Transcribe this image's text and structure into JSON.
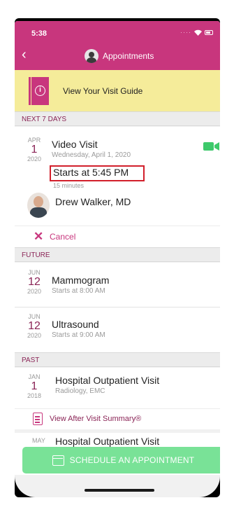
{
  "status": {
    "time": "5:38"
  },
  "nav": {
    "back": "‹",
    "title": "Appointments"
  },
  "guide": {
    "label": "View Your Visit Guide"
  },
  "sections": {
    "next7": "NEXT 7 DAYS",
    "future": "FUTURE",
    "past": "PAST"
  },
  "upcoming": {
    "month": "APR",
    "day": "1",
    "year": "2020",
    "title": "Video Visit",
    "date_text": "Wednesday, April 1, 2020",
    "starts": "Starts at 5:45 PM",
    "duration": "15 minutes",
    "provider": "Drew Walker, MD",
    "cancel_label": "Cancel"
  },
  "future": [
    {
      "month": "JUN",
      "day": "12",
      "year": "2020",
      "title": "Mammogram",
      "time": "Starts at 8:00 AM"
    },
    {
      "month": "JUN",
      "day": "12",
      "year": "2020",
      "title": "Ultrasound",
      "time": "Starts at 9:00 AM"
    }
  ],
  "past": [
    {
      "month": "JAN",
      "day": "1",
      "year": "2018",
      "title": "Hospital Outpatient Visit",
      "location": "Radiology, EMC",
      "summary_label": "View After Visit Summary®"
    },
    {
      "month": "MAY",
      "title": "Hospital Outpatient Visit"
    }
  ],
  "schedule_button": {
    "label": "SCHEDULE AN APPOINTMENT"
  },
  "colors": {
    "brand": "#c8367d",
    "banner": "#f5ec9a",
    "video": "#3ec96b",
    "button": "#6ee08f",
    "highlight": "#d21f2b"
  }
}
